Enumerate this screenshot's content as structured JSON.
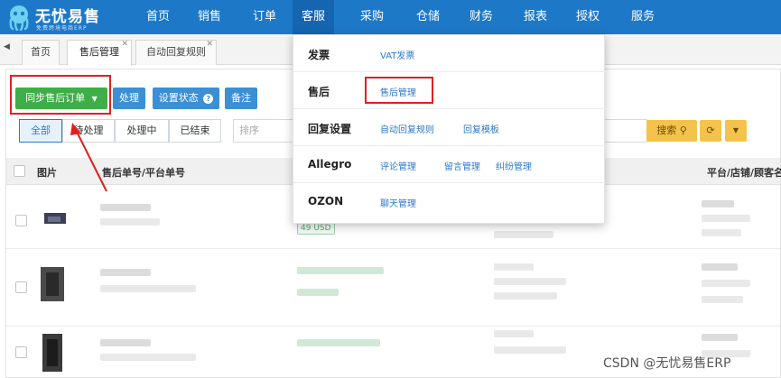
{
  "brand": {
    "name": "无忧易售",
    "slogan": "免费跨境电商ERP"
  },
  "nav": {
    "items": [
      "首页",
      "销售",
      "订单",
      "客服",
      "采购",
      "仓储",
      "财务",
      "报表",
      "授权",
      "服务"
    ],
    "active": "客服"
  },
  "tabs": [
    {
      "label": "首页"
    },
    {
      "label": "售后管理",
      "active": true
    },
    {
      "label": "自动回复规则"
    }
  ],
  "toolbar": {
    "sync_label": "同步售后订单",
    "process_label": "处理",
    "set_status_label": "设置状态",
    "note_label": "备注"
  },
  "filters": [
    "全部",
    "待处理",
    "处理中",
    "已结束"
  ],
  "search": {
    "placeholder": "排序",
    "button_label": "搜索"
  },
  "table": {
    "columns": [
      "图片",
      "售后单号/平台单号",
      "平台/店铺/顾客名"
    ],
    "rows": [
      {
        "price": "49 USD"
      },
      {
        "price": ""
      },
      {
        "price": ""
      }
    ]
  },
  "dropdown": {
    "groups": [
      {
        "category": "发票",
        "links": [
          "VAT发票"
        ]
      },
      {
        "category": "售后",
        "links": [
          "售后管理"
        ]
      },
      {
        "category": "回复设置",
        "links": [
          "自动回复规则",
          "回复模板"
        ]
      },
      {
        "category": "Allegro",
        "links": [
          "评论管理",
          "留言管理",
          "纠纷管理"
        ]
      },
      {
        "category": "OZON",
        "links": [
          "聊天管理"
        ]
      }
    ]
  },
  "watermark": "CSDN @无忧易售ERP",
  "colors": {
    "nav_bg": "#1e78c8",
    "highlight": "#e02020",
    "accent_green": "#3eae48",
    "link": "#2f79c8"
  }
}
